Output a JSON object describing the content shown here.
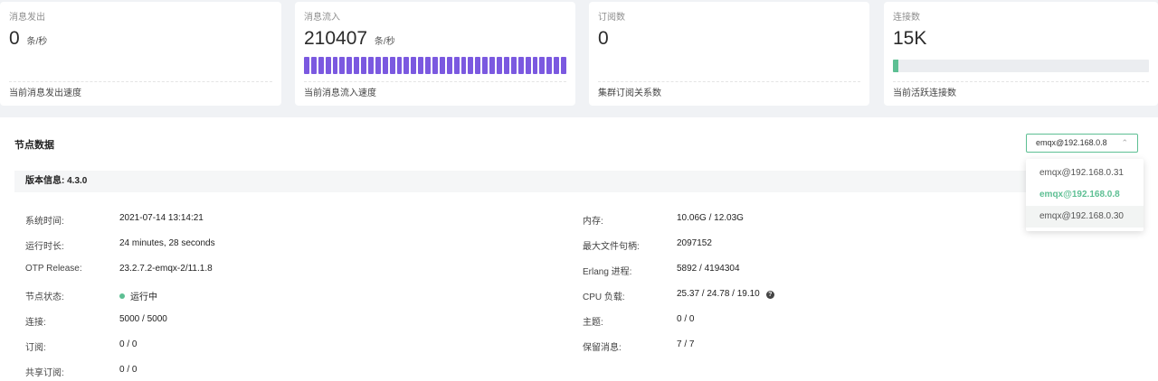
{
  "cards": [
    {
      "label": "消息发出",
      "value": "0",
      "unit": "条/秒",
      "foot": "当前消息发出速度"
    },
    {
      "label": "消息流入",
      "value": "210407",
      "unit": "条/秒",
      "foot": "当前消息流入速度",
      "bar_segments": 37,
      "bar_color": "#7b59e0"
    },
    {
      "label": "订阅数",
      "value": "0",
      "unit": "",
      "foot": "集群订阅关系数"
    },
    {
      "label": "连接数",
      "value": "15K",
      "unit": "",
      "foot": "当前活跃连接数",
      "progress_fraction": 0.02,
      "progress_color": "#5dbf93"
    }
  ],
  "panel": {
    "title": "节点数据",
    "select_value": "emqx@192.168.0.8",
    "select_icon": "chevron-up-icon",
    "dropdown_options": [
      "emqx@192.168.0.31",
      "emqx@192.168.0.8",
      "emqx@192.168.0.30"
    ],
    "version": "版本信息: 4.3.0"
  },
  "left_info": [
    {
      "key": "系统时间:",
      "value": "2021-07-14 13:14:21"
    },
    {
      "key": "运行时长:",
      "value": "24 minutes, 28 seconds"
    },
    {
      "key": "OTP Release:",
      "value": "23.2.7.2-emqx-2/11.1.8"
    },
    {
      "key": "节点状态:",
      "value": "运行中",
      "status_dot": true
    },
    {
      "key": "连接:",
      "value": "5000 / 5000"
    },
    {
      "key": "订阅:",
      "value": "0 / 0"
    },
    {
      "key": "共享订阅:",
      "value": "0 / 0"
    }
  ],
  "right_info": [
    {
      "key": "内存:",
      "value": "10.06G / 12.03G"
    },
    {
      "key": "最大文件句柄:",
      "value": "2097152"
    },
    {
      "key": "Erlang 进程:",
      "value": "5892 / 4194304"
    },
    {
      "key": "CPU 负载:",
      "value": "25.37 / 24.78 / 19.10",
      "help_icon": "?"
    },
    {
      "key": "主题:",
      "value": "0 / 0"
    },
    {
      "key": "保留消息:",
      "value": "7 / 7"
    }
  ],
  "colors": {
    "accent": "#5dbf93",
    "bar": "#7b59e0",
    "background": "#f0f2f5"
  }
}
